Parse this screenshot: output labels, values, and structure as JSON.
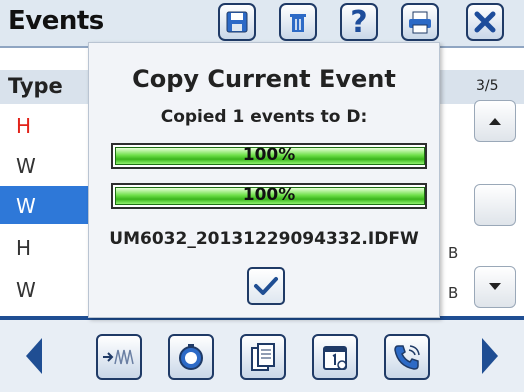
{
  "header": {
    "title": "Events",
    "buttons": [
      "save-icon",
      "trash-icon",
      "help-icon",
      "printer-icon",
      "close-icon"
    ],
    "help_glyph": "?"
  },
  "table": {
    "column_type": "Type",
    "page_indicator": "3/5",
    "rows": [
      {
        "type": "H",
        "color": "#e2231a",
        "selected": false
      },
      {
        "type": "W",
        "color": "#333333",
        "selected": false
      },
      {
        "type": "W",
        "color": "#ffffff",
        "selected": true
      },
      {
        "type": "H",
        "color": "#333333",
        "selected": false
      },
      {
        "type": "W",
        "color": "#333333",
        "selected": false
      }
    ],
    "right_snippets": [
      "B",
      "B"
    ]
  },
  "dialog": {
    "title": "Copy Current Event",
    "subtitle": "Copied 1 events to D:",
    "progress": [
      {
        "label": "100%",
        "value": 1.0
      },
      {
        "label": "100%",
        "value": 1.0
      }
    ],
    "filename": "UM6032_20131229094332.IDFW",
    "ok_icon": "checkmark-icon"
  },
  "bottom_bar": {
    "items": [
      "prev-arrow-icon",
      "waveform-icon",
      "meter-icon",
      "documents-icon",
      "calendar-icon",
      "phone-icon",
      "next-arrow-icon"
    ]
  },
  "colors": {
    "accent": "#1f4e93",
    "selection": "#2e78d8",
    "progress_green": "#3bb51c"
  }
}
